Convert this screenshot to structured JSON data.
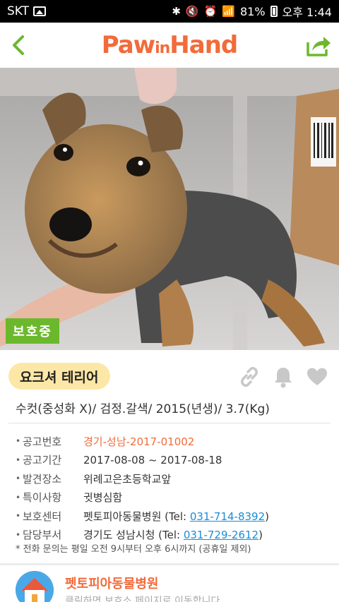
{
  "status_bar": {
    "carrier": "SKT",
    "battery": "81%",
    "time": "오후 1:44"
  },
  "header": {
    "logo_text_1": "Paw",
    "logo_text_2": "in",
    "logo_text_3": "Hand"
  },
  "photo": {
    "status_label": "보호중"
  },
  "animal": {
    "breed": "요크셔 테리어",
    "summary": "수컷(중성화 X)/ 검정.갈색/ 2015(년생)/ 3.7(Kg)"
  },
  "details": [
    {
      "label": "공고번호",
      "value": "경기-성남-2017-01002"
    },
    {
      "label": "공고기간",
      "value": "2017-08-08 ~ 2017-08-18"
    },
    {
      "label": "발견장소",
      "value": "위례고은초등학교앞"
    },
    {
      "label": "특이사항",
      "value": "귓병심함"
    },
    {
      "label": "보호센터",
      "value": "펫토피아동물병원 (Tel: ",
      "tel": "031-714-8392",
      "suffix": ")"
    },
    {
      "label": "담당부서",
      "value": "경기도 성남시청 (Tel: ",
      "tel": "031-729-2612",
      "suffix": ")"
    }
  ],
  "notice": "* 전화 문의는 평일 오전 9시부터 오후 6시까지 (공휴일 제외)",
  "shelter": {
    "name": "펫토피아동물병원",
    "subtitle": "클릭하면 보호소 페이지로 이동합니다"
  },
  "colors": {
    "brand": "#f26b3a",
    "status_chip": "#6bb82d",
    "link": "#1a8cd8",
    "breed_pill": "#fde7a6"
  }
}
